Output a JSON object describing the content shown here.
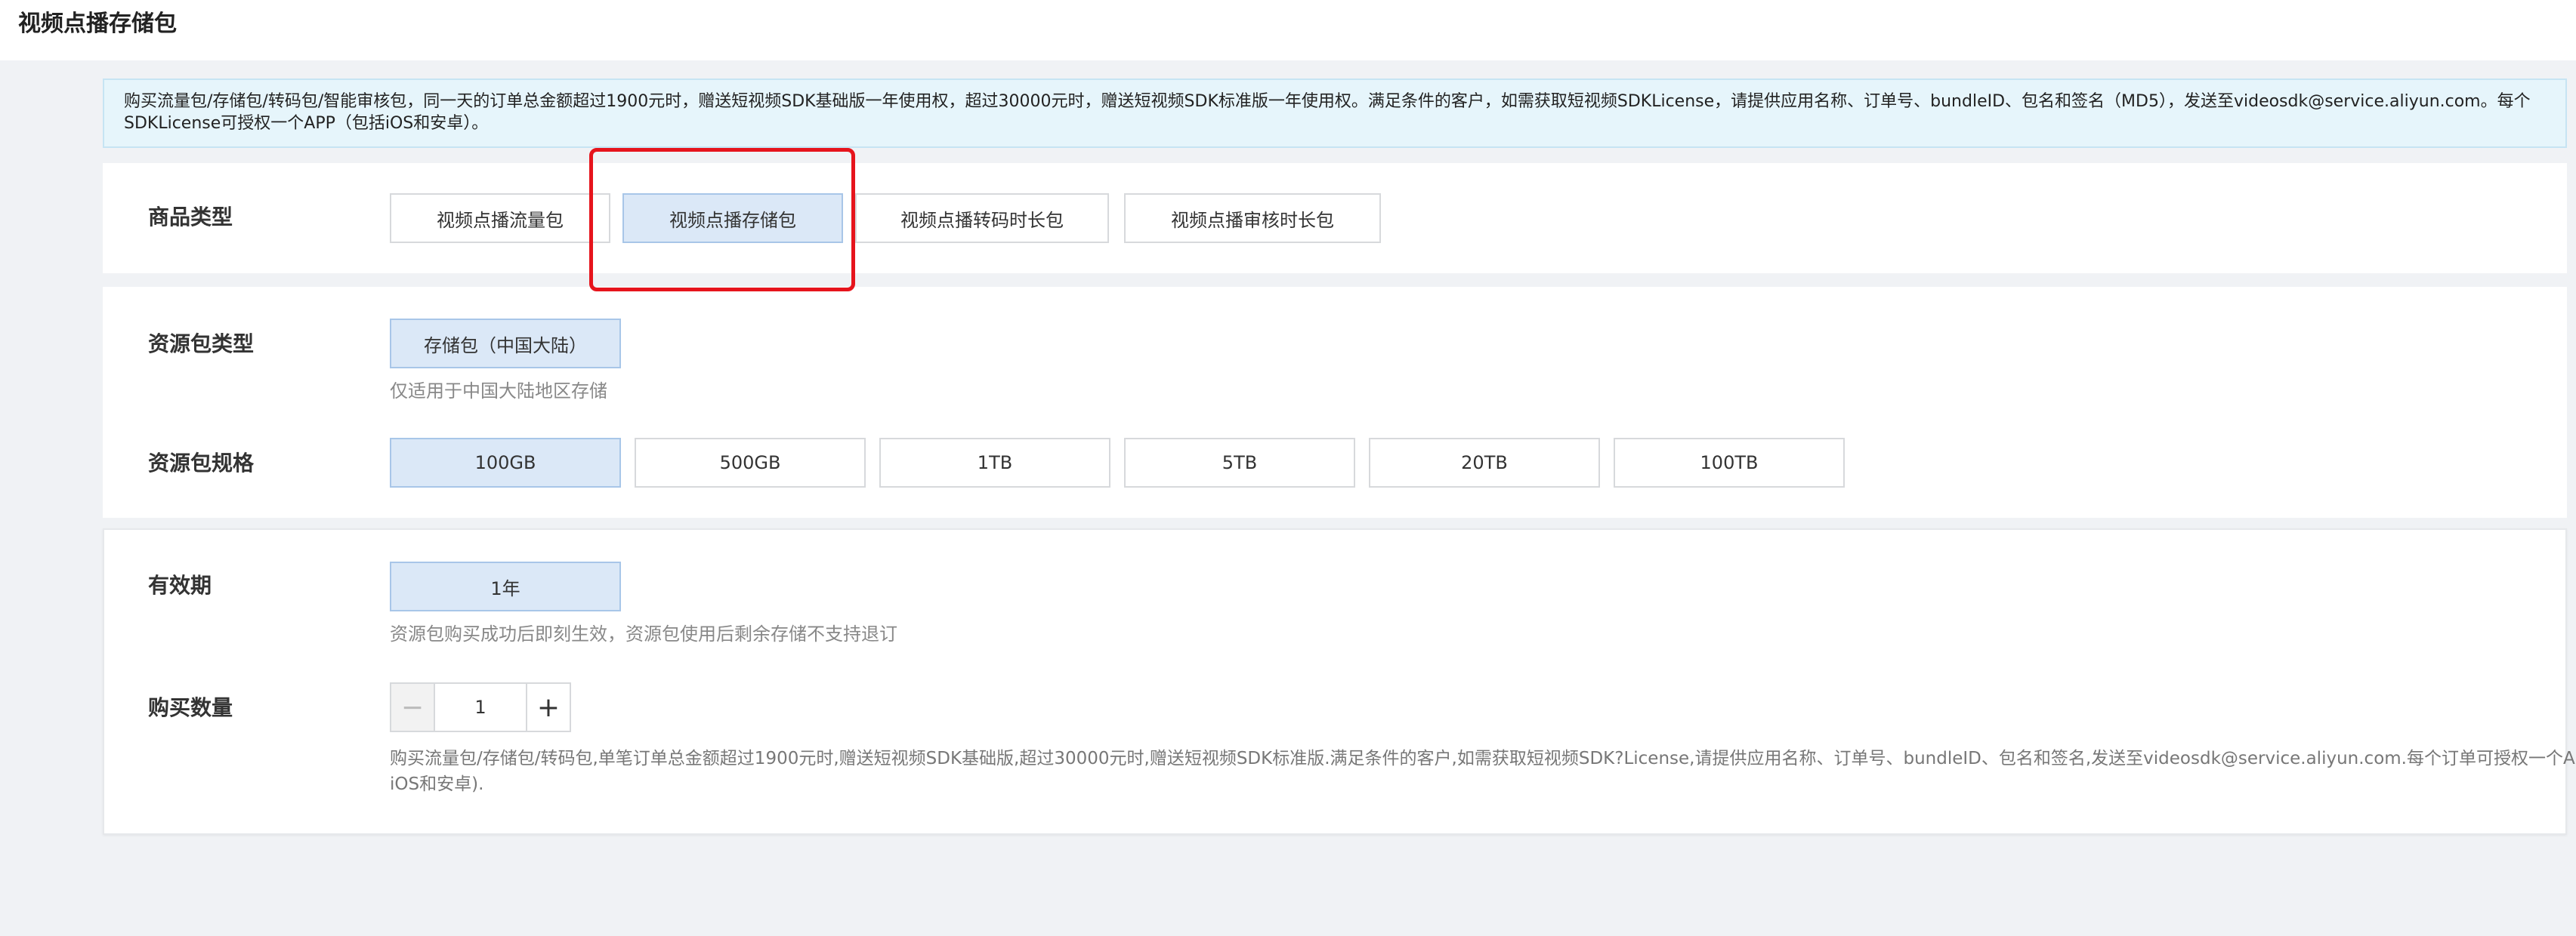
{
  "page": {
    "title": "视频点播存储包"
  },
  "notice": {
    "text": "购买流量包/存储包/转码包/智能审核包，同一天的订单总金额超过1900元时，赠送短视频SDK基础版一年使用权，超过30000元时，赠送短视频SDK标准版一年使用权。满足条件的客户，如需获取短视频SDKLicense，请提供应用名称、订单号、bundleID、包名和签名（MD5），发送至videosdk@service.aliyun.com。每个SDKLicense可授权一个APP（包括iOS和安卓）。"
  },
  "product_type": {
    "label": "商品类型",
    "options": [
      "视频点播流量包",
      "视频点播存储包",
      "视频点播转码时长包",
      "视频点播审核时长包"
    ],
    "selected": "视频点播存储包"
  },
  "package_type": {
    "label": "资源包类型",
    "options": [
      "存储包（中国大陆）"
    ],
    "selected": "存储包（中国大陆）",
    "hint": "仅适用于中国大陆地区存储"
  },
  "package_spec": {
    "label": "资源包规格",
    "options": [
      "100GB",
      "500GB",
      "1TB",
      "5TB",
      "20TB",
      "100TB"
    ],
    "selected": "100GB"
  },
  "validity": {
    "label": "有效期",
    "options": [
      "1年"
    ],
    "selected": "1年",
    "hint": "资源包购买成功后即刻生效，资源包使用后剩余存储不支持退订"
  },
  "quantity": {
    "label": "购买数量",
    "value": "1",
    "minus_symbol": "−",
    "plus_symbol": "+",
    "description": "购买流量包/存储包/转码包,单笔订单总金额超过1900元时,赠送短视频SDK基础版,超过30000元时,赠送短视频SDK标准版.满足条件的客户,如需获取短视频SDK?License,请提供应用名称、订单号、bundleID、包名和签名,发送至videosdk@service.aliyun.com.每个订单可授权一个APP(包括iOS和安卓)."
  },
  "colors": {
    "selected_bg": "#dbe8f7",
    "notice_bg": "#e6f5fb",
    "highlight_box": "#e6141c"
  }
}
